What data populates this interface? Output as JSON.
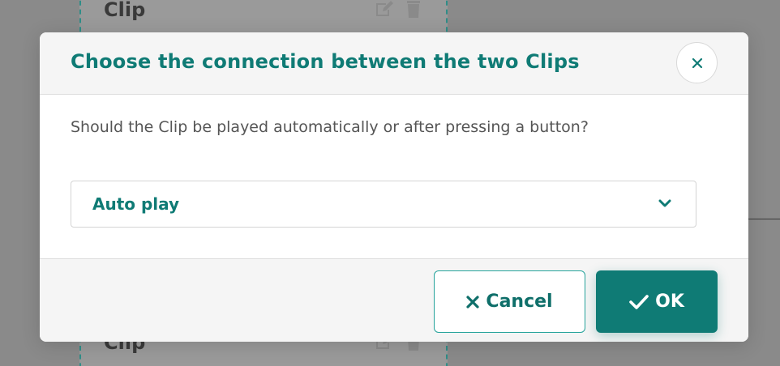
{
  "background": {
    "cards": [
      {
        "title": "Clip"
      },
      {
        "title": "Clip"
      }
    ]
  },
  "dialog": {
    "title": "Choose the connection between the two Clips",
    "question": "Should the Clip be played automatically or after pressing a button?",
    "select": {
      "selected": "Auto play"
    },
    "buttons": {
      "cancel_label": "Cancel",
      "ok_label": "OK"
    }
  },
  "colors": {
    "accent": "#0f7b75",
    "overlay": "#8a8a8a",
    "header_bg": "#f5f5f5"
  },
  "icons": {
    "close": "close-icon",
    "chevron": "chevron-down-icon",
    "cancel": "x-icon",
    "ok": "check-icon",
    "edit": "edit-icon",
    "delete": "trash-icon"
  }
}
